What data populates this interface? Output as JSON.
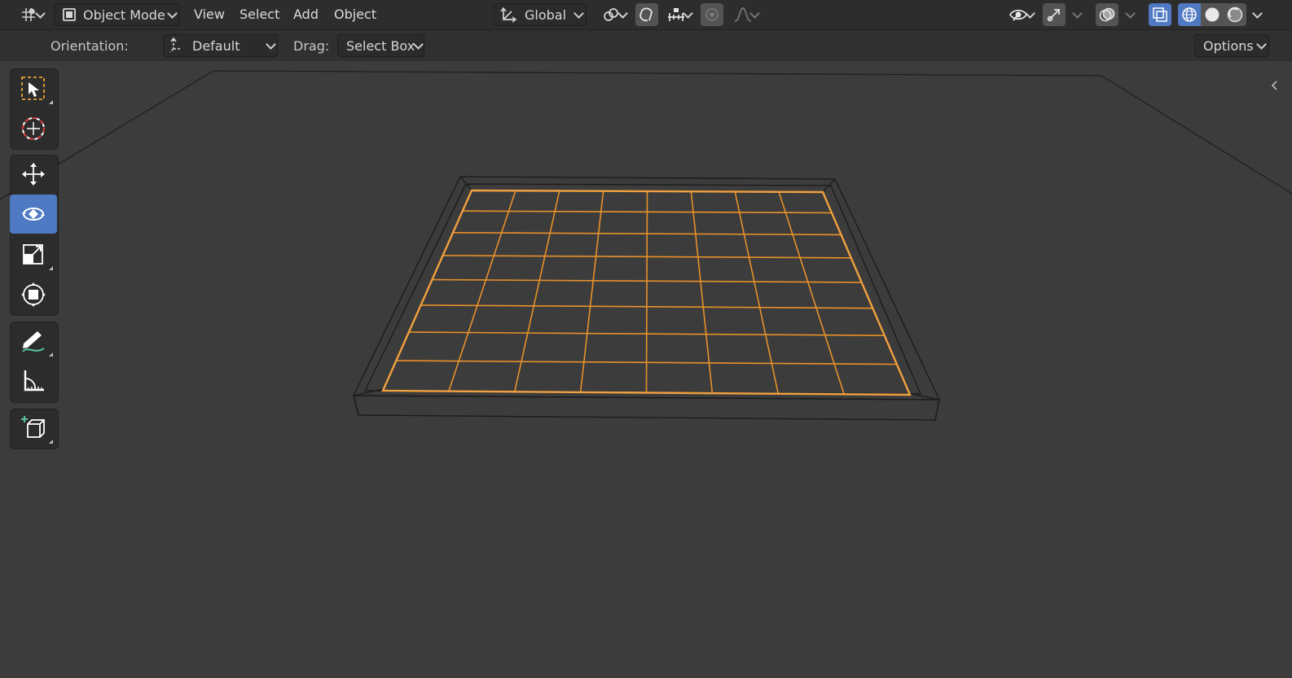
{
  "header": {
    "mode_label": "Object Mode",
    "menus": [
      "View",
      "Select",
      "Add",
      "Object"
    ],
    "transform_orientation": "Global",
    "options_label": "Options"
  },
  "subheader": {
    "orientation_label": "Orientation:",
    "orientation_value": "Default",
    "drag_label": "Drag:",
    "drag_value": "Select Box"
  },
  "toolbar": {
    "tools": [
      {
        "name": "select-box-tool",
        "icon": "select-box-icon"
      },
      {
        "name": "cursor-tool",
        "icon": "cursor-icon"
      },
      {
        "name": "move-tool",
        "icon": "move-icon"
      },
      {
        "name": "rotate-tool",
        "icon": "rotate-icon",
        "active": true
      },
      {
        "name": "scale-tool",
        "icon": "scale-icon"
      },
      {
        "name": "transform-tool",
        "icon": "transform-icon"
      },
      {
        "name": "annotate-tool",
        "icon": "annotate-icon"
      },
      {
        "name": "measure-tool",
        "icon": "measure-icon"
      },
      {
        "name": "add-cube-tool",
        "icon": "add-cube-icon"
      }
    ]
  },
  "colors": {
    "accent": "#4f79c2",
    "selection_outline": "#e8912a",
    "header_bg": "#2d2d2d",
    "viewport_bg": "#3c3c3c"
  },
  "viewport": {
    "object": "grid-plane",
    "grid_divisions": 8
  }
}
